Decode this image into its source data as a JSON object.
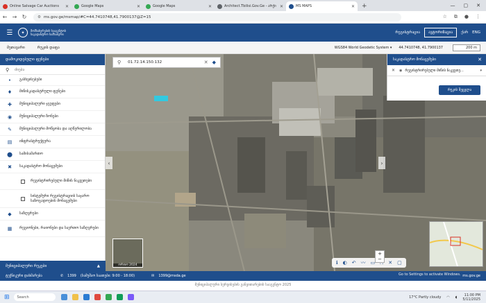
{
  "browser": {
    "tabs": [
      {
        "label": "Online Salvage Car Auctions",
        "color": "#d93025",
        "active": false
      },
      {
        "label": "Google Maps",
        "color": "#34a853",
        "active": false
      },
      {
        "label": "Google Maps",
        "color": "#34a853",
        "active": false
      },
      {
        "label": "Architect.Tbilisi.Gov.Ge - არქი",
        "color": "#5f6368",
        "active": false
      },
      {
        "label": "MS MAPS",
        "color": "#1f4e8c",
        "active": true
      }
    ],
    "url": "ms.gov.ge/msmap/#C=44.7410748,41.7900137@Z=15"
  },
  "header": {
    "logo_text": "მომსახურების სააგენტოს საკადასტრო სამსახური",
    "menu": [
      "რეგისტრაცია",
      "ავტორიზაცია",
      "ქარ",
      "ENG"
    ]
  },
  "toolbar": {
    "item1": "მეთავარი",
    "item2": "რუკის დაფა",
    "crs": "WGS84 World Geodetic System",
    "coords": "44.7410748, 41.7900137",
    "scale": "200 m"
  },
  "sidebar": {
    "title": "დამოკიდებული ფენები",
    "search_placeholder": "ძიება",
    "layers": [
      {
        "label": "გასხვისებები",
        "icon": "•",
        "sub": false
      },
      {
        "label": "მიწისკადასტრული ფენები",
        "icon": "♦",
        "sub": false
      },
      {
        "label": "მუნიციპალური ჯგუფები",
        "icon": "✚",
        "sub": false
      },
      {
        "label": "მუნიციპალური ზონები",
        "icon": "◉",
        "sub": false
      },
      {
        "label": "მუნიციპალური მოწყობა და აღწერილობა",
        "icon": "✎",
        "sub": false
      },
      {
        "label": "ინფრასტრუქტურა",
        "icon": "▤",
        "sub": false
      },
      {
        "label": "სამისამართო",
        "icon": "⬤",
        "sub": false
      },
      {
        "label": "საკადასტრო მონაცემები",
        "icon": "✖",
        "sub": false
      },
      {
        "label": "რეგისტრირებული მიწის ნაკვეთები",
        "icon": "",
        "sub": true
      },
      {
        "label": "სისტემური რეგისტრაციის საჯარო საზოგადოების მონაცემები",
        "icon": "",
        "sub": true
      },
      {
        "label": "საზღვრები",
        "icon": "◆",
        "sub": false
      },
      {
        "label": "რეგიონები, რაიონები და საერთო საზღვრები",
        "icon": "▦",
        "sub": false
      }
    ],
    "footer": "მუნიციპალური რუკები"
  },
  "map": {
    "search_value": "01.72.14.150.132",
    "minimap_label": "ორთო 2024",
    "tools": [
      "ℹ",
      "◐",
      "↶",
      "〰",
      "▭",
      "⛶",
      "✕",
      "▢"
    ]
  },
  "panel": {
    "title": "საკადასტრო მონაცემები",
    "row": "რეგისტრირებული მიწის ნაკვეთე...",
    "button": "რუკის შეცვლა"
  },
  "footer": {
    "help": "ტექნიკური დახმარება",
    "phone": "1399",
    "hours": "(სამუშაო საათები: 9:00 - 18:00)",
    "email": "1399@msda.ge",
    "site": "ms.gov.ge",
    "copyright": "მუნიციპალური სერვისების განვითარების სააგენტო 2025",
    "activate": "Go to Settings to activate Windows."
  },
  "taskbar": {
    "search": "Search",
    "weather": "17°C  Partly cloudy",
    "time": "11:00 PM",
    "date": "5/11/2025"
  }
}
